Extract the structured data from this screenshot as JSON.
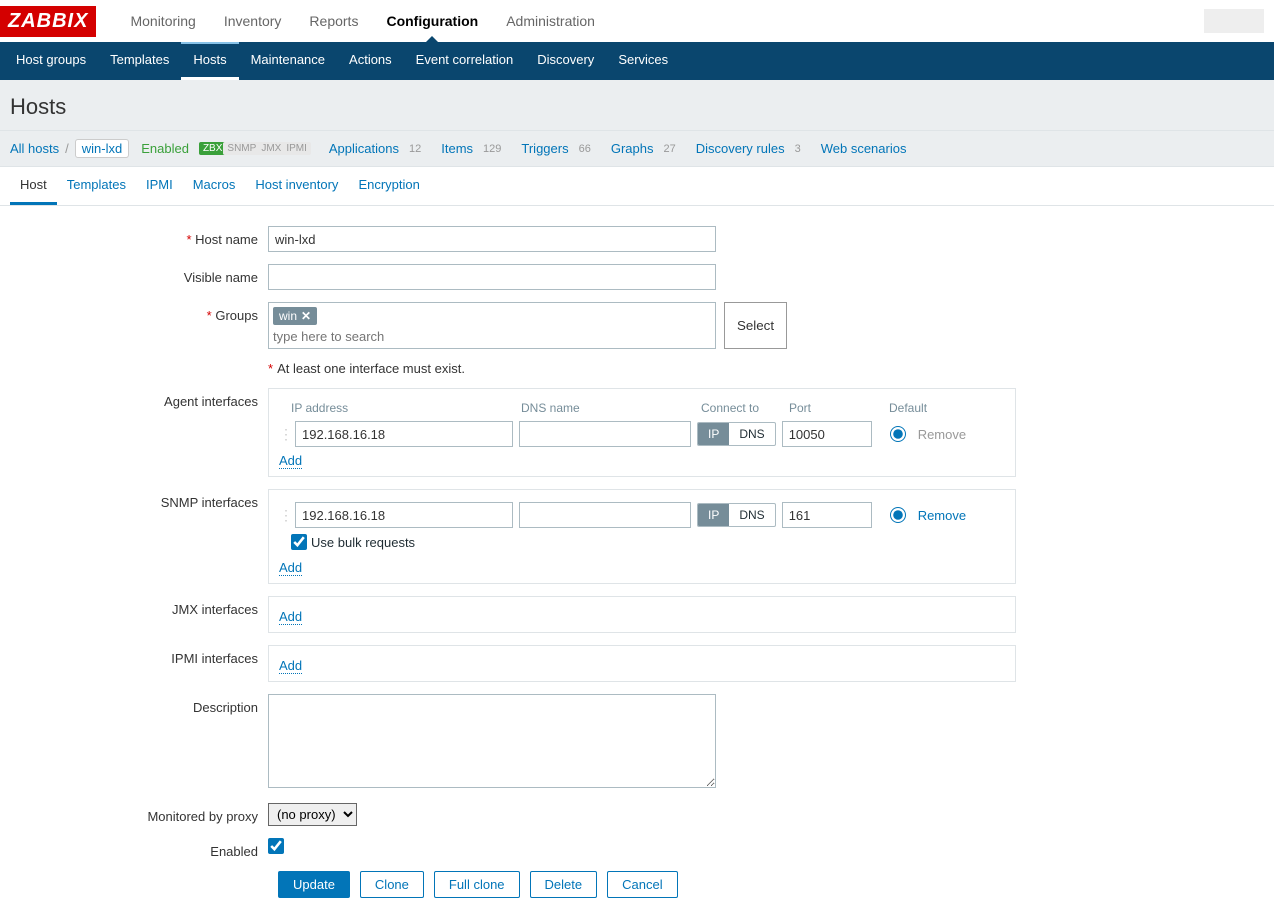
{
  "logo": "ZABBIX",
  "topnav": {
    "monitoring": "Monitoring",
    "inventory": "Inventory",
    "reports": "Reports",
    "configuration": "Configuration",
    "administration": "Administration"
  },
  "subnav": {
    "hostgroups": "Host groups",
    "templates": "Templates",
    "hosts": "Hosts",
    "maintenance": "Maintenance",
    "actions": "Actions",
    "eventcorr": "Event correlation",
    "discovery": "Discovery",
    "services": "Services"
  },
  "page_title": "Hosts",
  "breadcrumb": {
    "all_hosts": "All hosts",
    "host": "win-lxd",
    "enabled": "Enabled",
    "tags": {
      "zbx": "ZBX",
      "snmp": "SNMP",
      "jmx": "JMX",
      "ipmi": "IPMI"
    },
    "stats": {
      "applications_label": "Applications",
      "applications_count": "12",
      "items_label": "Items",
      "items_count": "129",
      "triggers_label": "Triggers",
      "triggers_count": "66",
      "graphs_label": "Graphs",
      "graphs_count": "27",
      "discovery_label": "Discovery rules",
      "discovery_count": "3",
      "web_label": "Web scenarios"
    }
  },
  "form_tabs": {
    "host": "Host",
    "templates": "Templates",
    "ipmi": "IPMI",
    "macros": "Macros",
    "hostinv": "Host inventory",
    "encryption": "Encryption"
  },
  "labels": {
    "host_name": "Host name",
    "visible_name": "Visible name",
    "groups": "Groups",
    "select": "Select",
    "groups_placeholder": "type here to search",
    "interface_note": "At least one interface must exist.",
    "agent_if": "Agent interfaces",
    "snmp_if": "SNMP interfaces",
    "jmx_if": "JMX interfaces",
    "ipmi_if": "IPMI interfaces",
    "col_ip": "IP address",
    "col_dns": "DNS name",
    "col_conn": "Connect to",
    "col_port": "Port",
    "col_default": "Default",
    "ip": "IP",
    "dns": "DNS",
    "remove": "Remove",
    "add": "Add",
    "bulk": "Use bulk requests",
    "description": "Description",
    "proxy": "Monitored by proxy",
    "enabled": "Enabled"
  },
  "form": {
    "host_name": "win-lxd",
    "visible_name": "",
    "group_chip": "win",
    "agent": {
      "ip": "192.168.16.18",
      "dns": "",
      "port": "10050"
    },
    "snmp": {
      "ip": "192.168.16.18",
      "dns": "",
      "port": "161"
    },
    "description": "",
    "proxy": "(no proxy)"
  },
  "buttons": {
    "update": "Update",
    "clone": "Clone",
    "full_clone": "Full clone",
    "delete": "Delete",
    "cancel": "Cancel"
  }
}
